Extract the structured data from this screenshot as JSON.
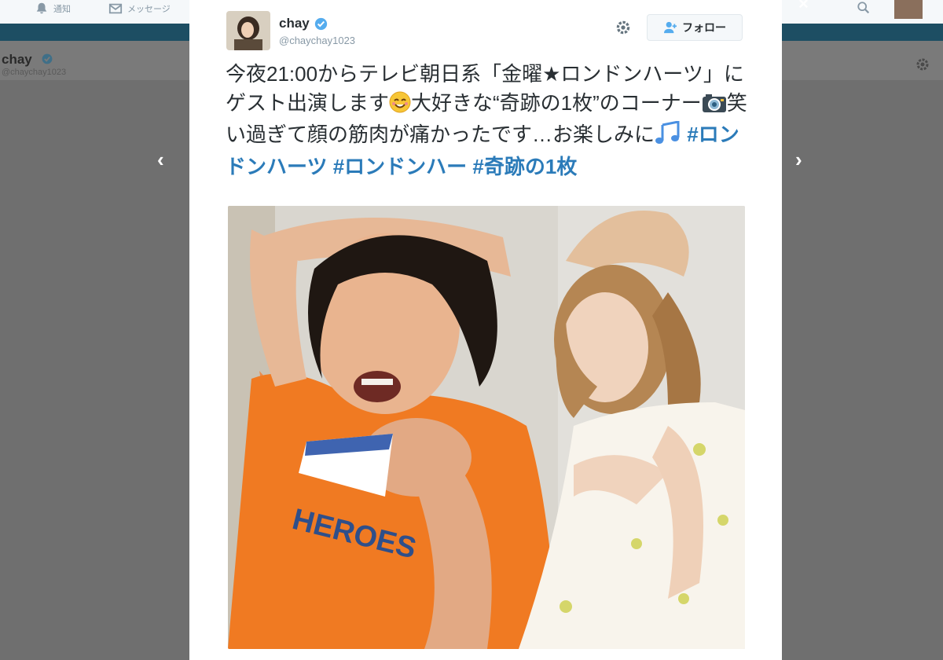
{
  "nav": {
    "home_label": "通知",
    "messages_label": "メッセージ"
  },
  "background_profile": {
    "name": "chay",
    "handle": "@chaychay1023"
  },
  "tweet": {
    "user_name": "chay",
    "handle": "@chaychay1023",
    "follow_label": "フォロー",
    "text_parts": {
      "p1": "今夜21:00からテレビ朝日系「金曜★ロンドンハーツ」にゲスト出演します",
      "p2": "大好きな“奇跡の1枚”のコーナー",
      "p3": "笑い過ぎて顔の筋肉が痛かったです…お楽しみに",
      "tag1": "#ロンドンハーツ",
      "tag2": "#ロンドンハー",
      "tag3": "#奇跡の1枚"
    },
    "shirt_text": "HEROES"
  },
  "colors": {
    "accent_link": "#2b7bb9",
    "verified": "#55acee",
    "nav_band": "#1d4e63",
    "overlay": "#6f6f6f"
  },
  "icons": [
    "bell-icon",
    "envelope-icon",
    "search-icon",
    "close-icon",
    "verified-badge-icon",
    "gear-icon",
    "follow-person-icon",
    "smile-emoji-icon",
    "camera-emoji-icon",
    "music-notes-emoji-icon",
    "chevron-left-icon",
    "chevron-right-icon"
  ]
}
